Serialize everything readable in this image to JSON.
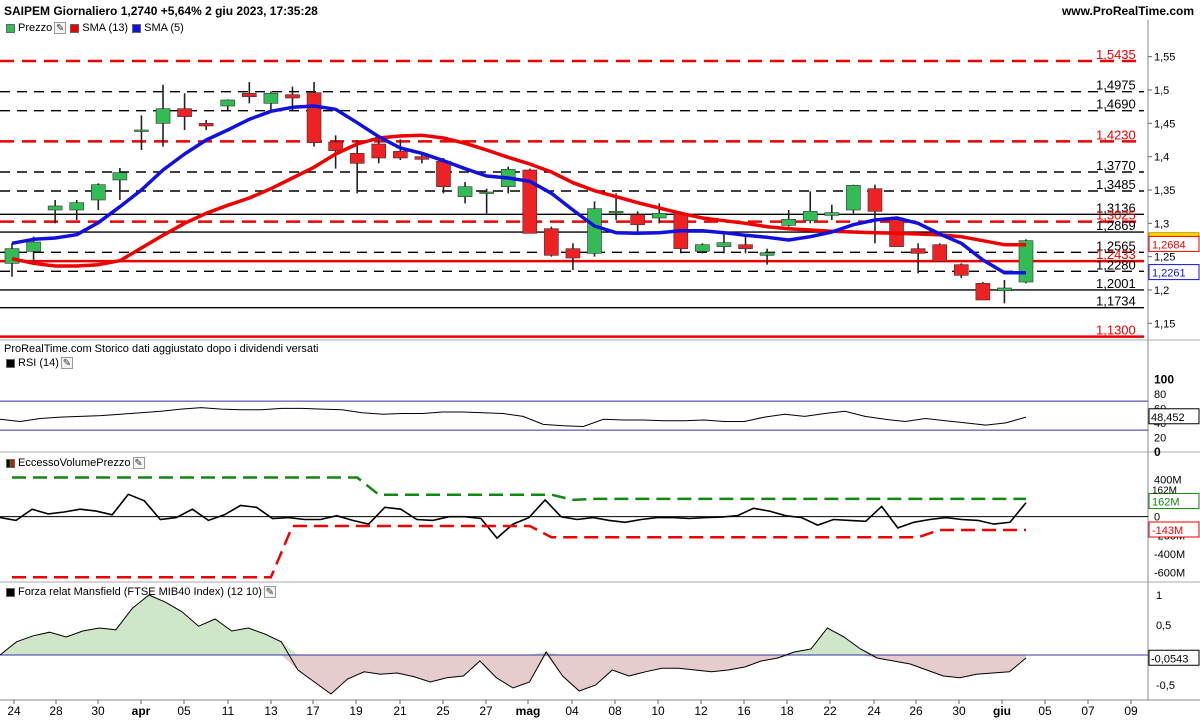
{
  "header": {
    "title": "SAIPEM Giornaliero 1,2740 +5,64% 2 giu 2023, 17:35:28",
    "site": "www.ProRealTime.com"
  },
  "footnote": "ProRealTime.com  Storico dati aggiustato dopo i dividendi versati",
  "colors": {
    "up": "#33bb55",
    "down": "#ee2222",
    "sma13": "#ee0000",
    "sma5": "#1111dd",
    "rsi_band": "#3333aa",
    "volume_upper": "#118811",
    "volume_lower": "#ee0000",
    "mansfield_fill_pos": "#cfe6c8",
    "mansfield_fill_neg": "#e6cccc"
  },
  "chart_data": [
    {
      "type": "candlestick",
      "legend": [
        {
          "name": "Prezzo",
          "color": "#33bb55"
        },
        {
          "name": "SMA (13)",
          "color": "#ee0000"
        },
        {
          "name": "SMA (5)",
          "color": "#1111dd"
        }
      ],
      "x_tick_labels": [
        "24",
        "28",
        "30",
        "apr",
        "05",
        "11",
        "13",
        "17",
        "19",
        "21",
        "25",
        "27",
        "mag",
        "04",
        "08",
        "10",
        "12",
        "16",
        "18",
        "22",
        "24",
        "26",
        "30",
        "giu",
        "05",
        "07",
        "09"
      ],
      "y_ticks": [
        "1,55",
        "1,5",
        "1,45",
        "1,4",
        "1,35",
        "1,3",
        "1,25",
        "1,2",
        "1,15"
      ],
      "ylim": [
        1.125,
        1.575
      ],
      "candles": [
        {
          "o": 1.24,
          "h": 1.27,
          "l": 1.22,
          "c": 1.262
        },
        {
          "o": 1.258,
          "h": 1.28,
          "l": 1.24,
          "c": 1.272
        },
        {
          "o": 1.32,
          "h": 1.335,
          "l": 1.3,
          "c": 1.326
        },
        {
          "o": 1.32,
          "h": 1.335,
          "l": 1.305,
          "c": 1.331
        },
        {
          "o": 1.335,
          "h": 1.36,
          "l": 1.32,
          "c": 1.358
        },
        {
          "o": 1.365,
          "h": 1.383,
          "l": 1.335,
          "c": 1.376
        },
        {
          "o": 1.44,
          "h": 1.462,
          "l": 1.41,
          "c": 1.44
        },
        {
          "o": 1.45,
          "h": 1.508,
          "l": 1.415,
          "c": 1.472
        },
        {
          "o": 1.472,
          "h": 1.495,
          "l": 1.44,
          "c": 1.46
        },
        {
          "o": 1.45,
          "h": 1.455,
          "l": 1.44,
          "c": 1.446
        },
        {
          "o": 1.476,
          "h": 1.486,
          "l": 1.47,
          "c": 1.485
        },
        {
          "o": 1.495,
          "h": 1.512,
          "l": 1.48,
          "c": 1.49
        },
        {
          "o": 1.48,
          "h": 1.498,
          "l": 1.47,
          "c": 1.495
        },
        {
          "o": 1.493,
          "h": 1.505,
          "l": 1.47,
          "c": 1.488
        },
        {
          "o": 1.496,
          "h": 1.512,
          "l": 1.415,
          "c": 1.421
        },
        {
          "o": 1.422,
          "h": 1.432,
          "l": 1.382,
          "c": 1.409
        },
        {
          "o": 1.405,
          "h": 1.425,
          "l": 1.345,
          "c": 1.39
        },
        {
          "o": 1.419,
          "h": 1.432,
          "l": 1.39,
          "c": 1.398
        },
        {
          "o": 1.408,
          "h": 1.426,
          "l": 1.395,
          "c": 1.398
        },
        {
          "o": 1.4,
          "h": 1.405,
          "l": 1.39,
          "c": 1.396
        },
        {
          "o": 1.393,
          "h": 1.398,
          "l": 1.345,
          "c": 1.355
        },
        {
          "o": 1.34,
          "h": 1.362,
          "l": 1.33,
          "c": 1.355
        },
        {
          "o": 1.347,
          "h": 1.352,
          "l": 1.315,
          "c": 1.347
        },
        {
          "o": 1.355,
          "h": 1.385,
          "l": 1.345,
          "c": 1.381
        },
        {
          "o": 1.38,
          "h": 1.382,
          "l": 1.285,
          "c": 1.285
        },
        {
          "o": 1.292,
          "h": 1.295,
          "l": 1.25,
          "c": 1.252
        },
        {
          "o": 1.262,
          "h": 1.27,
          "l": 1.23,
          "c": 1.248
        },
        {
          "o": 1.255,
          "h": 1.333,
          "l": 1.25,
          "c": 1.322
        },
        {
          "o": 1.318,
          "h": 1.345,
          "l": 1.305,
          "c": 1.318
        },
        {
          "o": 1.313,
          "h": 1.318,
          "l": 1.285,
          "c": 1.298
        },
        {
          "o": 1.308,
          "h": 1.33,
          "l": 1.3,
          "c": 1.315
        },
        {
          "o": 1.315,
          "h": 1.318,
          "l": 1.255,
          "c": 1.262
        },
        {
          "o": 1.258,
          "h": 1.27,
          "l": 1.255,
          "c": 1.268
        },
        {
          "o": 1.265,
          "h": 1.285,
          "l": 1.255,
          "c": 1.271
        },
        {
          "o": 1.268,
          "h": 1.28,
          "l": 1.255,
          "c": 1.262
        },
        {
          "o": 1.252,
          "h": 1.262,
          "l": 1.238,
          "c": 1.256
        },
        {
          "o": 1.297,
          "h": 1.32,
          "l": 1.295,
          "c": 1.306
        },
        {
          "o": 1.304,
          "h": 1.348,
          "l": 1.3,
          "c": 1.318
        },
        {
          "o": 1.312,
          "h": 1.328,
          "l": 1.305,
          "c": 1.316
        },
        {
          "o": 1.32,
          "h": 1.358,
          "l": 1.315,
          "c": 1.357
        },
        {
          "o": 1.352,
          "h": 1.358,
          "l": 1.27,
          "c": 1.318
        },
        {
          "o": 1.308,
          "h": 1.31,
          "l": 1.265,
          "c": 1.265
        },
        {
          "o": 1.262,
          "h": 1.27,
          "l": 1.225,
          "c": 1.255
        },
        {
          "o": 1.268,
          "h": 1.27,
          "l": 1.243,
          "c": 1.243
        },
        {
          "o": 1.238,
          "h": 1.24,
          "l": 1.218,
          "c": 1.222
        },
        {
          "o": 1.21,
          "h": 1.212,
          "l": 1.185,
          "c": 1.185
        },
        {
          "o": 1.199,
          "h": 1.215,
          "l": 1.18,
          "c": 1.203
        },
        {
          "o": 1.212,
          "h": 1.276,
          "l": 1.21,
          "c": 1.274
        }
      ],
      "sma13": [
        1.247,
        1.24,
        1.236,
        1.236,
        1.238,
        1.244,
        1.263,
        1.282,
        1.3,
        1.315,
        1.327,
        1.338,
        1.352,
        1.368,
        1.384,
        1.404,
        1.419,
        1.428,
        1.431,
        1.432,
        1.428,
        1.42,
        1.41,
        1.399,
        1.389,
        1.377,
        1.361,
        1.349,
        1.34,
        1.331,
        1.323,
        1.315,
        1.308,
        1.304,
        1.3,
        1.295,
        1.292,
        1.29,
        1.288,
        1.287,
        1.286,
        1.285,
        1.284,
        1.283,
        1.28,
        1.274,
        1.268,
        1.268
      ],
      "sma5": [
        1.27,
        1.276,
        1.278,
        1.283,
        1.301,
        1.325,
        1.35,
        1.38,
        1.404,
        1.425,
        1.44,
        1.456,
        1.468,
        1.474,
        1.476,
        1.471,
        1.451,
        1.43,
        1.413,
        1.405,
        1.394,
        1.382,
        1.371,
        1.368,
        1.363,
        1.345,
        1.32,
        1.296,
        1.286,
        1.285,
        1.286,
        1.289,
        1.289,
        1.286,
        1.282,
        1.279,
        1.275,
        1.28,
        1.287,
        1.298,
        1.305,
        1.308,
        1.3,
        1.284,
        1.27,
        1.245,
        1.226,
        1.226
      ],
      "horizontal_levels": [
        {
          "value": 1.5435,
          "label": "1,5435",
          "style": "red-dashed"
        },
        {
          "value": 1.4975,
          "label": "1,4975",
          "style": "black-dashed"
        },
        {
          "value": 1.469,
          "label": "1,4690",
          "style": "black-dashed"
        },
        {
          "value": 1.423,
          "label": "1,4230",
          "style": "red-dashed"
        },
        {
          "value": 1.377,
          "label": "1,3770",
          "style": "black-dashed"
        },
        {
          "value": 1.3485,
          "label": "1,3485",
          "style": "black-dashed"
        },
        {
          "value": 1.3136,
          "label": "1,3136",
          "style": "black-solid"
        },
        {
          "value": 1.3025,
          "label": "1,3025",
          "style": "red-dashed"
        },
        {
          "value": 1.2869,
          "label": "1,2869",
          "style": "black-solid"
        },
        {
          "value": 1.2565,
          "label": "1,2565",
          "style": "black-dashed"
        },
        {
          "value": 1.2433,
          "label": "1,2433",
          "style": "red-solid"
        },
        {
          "value": 1.228,
          "label": "1,2280",
          "style": "black-dashed"
        },
        {
          "value": 1.2001,
          "label": "1,2001",
          "style": "black-solid"
        },
        {
          "value": 1.1734,
          "label": "1,1734",
          "style": "black-solid"
        },
        {
          "value": 1.13,
          "label": "1,1300",
          "style": "red-solid"
        }
      ],
      "value_tags": [
        {
          "value": 1.274,
          "label": "1,2740",
          "bg": "#ffd700",
          "fg": "#000000"
        },
        {
          "value": 1.2684,
          "label": "1,2684",
          "bg": "#ffffff",
          "fg": "#ee0000"
        },
        {
          "value": 1.2261,
          "label": "1,2261",
          "bg": "#ffffff",
          "fg": "#1111dd"
        }
      ]
    },
    {
      "type": "line",
      "title": "RSI (14)",
      "ylim": [
        0,
        110
      ],
      "y_ticks": [
        "100",
        "80",
        "60",
        "40",
        "20",
        "0"
      ],
      "bands": [
        70,
        30
      ],
      "last_value": "48,452",
      "values": [
        45,
        42,
        46,
        48,
        49,
        50,
        52,
        54,
        56,
        59,
        61,
        59,
        58,
        58,
        60,
        60,
        59,
        58,
        54,
        52,
        53,
        53,
        55,
        55,
        54,
        53,
        49,
        38,
        36,
        35,
        45,
        44,
        44,
        43,
        43,
        44,
        42,
        42,
        48,
        52,
        49,
        53,
        56,
        49,
        45,
        42,
        46,
        43,
        40,
        37,
        40,
        48
      ]
    },
    {
      "type": "line",
      "title": "EccessoVolumePrezzo",
      "ylim": [
        -700,
        500
      ],
      "y_ticks": [
        "400M",
        "0",
        "-200M",
        "-400M",
        "-600M"
      ],
      "series_values": {
        "main": [
          -10,
          -40,
          80,
          30,
          50,
          80,
          60,
          20,
          240,
          170,
          -30,
          -10,
          80,
          -40,
          20,
          120,
          100,
          -20,
          -10,
          -30,
          -30,
          10,
          -40,
          -80,
          100,
          80,
          -30,
          -40,
          0,
          0,
          -20,
          -230,
          -80,
          -10,
          180,
          0,
          -30,
          -10,
          -40,
          -60,
          -30,
          -10,
          -10,
          -20,
          -10,
          -5,
          10,
          90,
          60,
          10,
          -10,
          -90,
          -30,
          -40,
          -50,
          110,
          -120,
          -60,
          -30,
          -10,
          -30,
          -40,
          -80,
          -60,
          150
        ],
        "upper": [
          null,
          null,
          null,
          null,
          null,
          null,
          null,
          null,
          null,
          null,
          null,
          null,
          null,
          null,
          null,
          null,
          null,
          null,
          null,
          null,
          null,
          null,
          null,
          null,
          null,
          null,
          null,
          null,
          null,
          null,
          null,
          null,
          null,
          null,
          null,
          null,
          null,
          null,
          null,
          null,
          null,
          null,
          null,
          null,
          null,
          null,
          null,
          null,
          null,
          null,
          null,
          null,
          null,
          null,
          null,
          null,
          null,
          null,
          null,
          null,
          null,
          null,
          null,
          null,
          null
        ]
      },
      "upper_points": [
        [
          0,
          420
        ],
        [
          16,
          420
        ],
        [
          17,
          235
        ],
        [
          25,
          235
        ],
        [
          26,
          180
        ],
        [
          27,
          190
        ],
        [
          40,
          190
        ],
        [
          47,
          190
        ]
      ],
      "lower_points": [
        [
          0,
          -650
        ],
        [
          12,
          -650
        ],
        [
          13,
          -100
        ],
        [
          24,
          -100
        ],
        [
          25,
          -220
        ],
        [
          42,
          -220
        ],
        [
          43,
          -143
        ],
        [
          47,
          -143
        ]
      ],
      "labels": [
        {
          "value": "162M",
          "color": "#118811"
        },
        {
          "value": "-143M",
          "color": "#ee0000"
        },
        {
          "value": "162M",
          "color": "#000000"
        }
      ]
    },
    {
      "type": "area",
      "title": "Forza relat Mansfield (FTSE MIB40 Index) (12 10)",
      "ylim": [
        -0.75,
        1.05
      ],
      "y_ticks": [
        "1",
        "0,5",
        "0",
        "-0,5"
      ],
      "last_value": "-0,0543",
      "values": [
        0.0,
        0.22,
        0.32,
        0.38,
        0.3,
        0.4,
        0.45,
        0.42,
        0.78,
        1.0,
        0.88,
        0.72,
        0.48,
        0.6,
        0.4,
        0.45,
        0.35,
        0.22,
        -0.25,
        -0.45,
        -0.65,
        -0.4,
        -0.28,
        -0.32,
        -0.3,
        -0.36,
        -0.45,
        -0.38,
        -0.35,
        -0.1,
        -0.38,
        -0.55,
        -0.45,
        0.05,
        -0.35,
        -0.6,
        -0.5,
        -0.25,
        -0.35,
        -0.28,
        -0.22,
        -0.22,
        -0.25,
        -0.28,
        -0.25,
        -0.2,
        -0.1,
        -0.05,
        0.05,
        0.1,
        0.45,
        0.3,
        0.1,
        -0.05,
        -0.1,
        -0.15,
        -0.25,
        -0.35,
        -0.38,
        -0.32,
        -0.3,
        -0.28,
        -0.05
      ]
    }
  ]
}
